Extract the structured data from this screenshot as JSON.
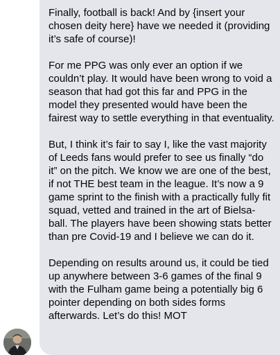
{
  "message": {
    "paragraphs": [
      "Finally, football is back! And by {insert your chosen deity here} have we needed it (providing it’s safe of course)!",
      "For me PPG was only ever an option if we couldn’t play. It would have been wrong to void a season that had got this far and PPG in the model they presented would have been the fairest way to settle everything in that eventuality.",
      "But, I think it’s fair to say I, like the vast majority of Leeds fans would prefer to see us finally “do it” on the pitch. We know we are one of the best, if not THE best team in the league. It’s now a 9 game sprint to the finish with a practically fully fit squad, vetted and trained in the art of Bielsa-ball. The players have been showing stats better than pre Covid-19 and I believe we can do it.",
      "Depending on results around us, it could be tied up anywhere between 3-6 games of the final 9 with the Fulham game being a potentially big 6 pointer depending on both sides forms afterwards. Let’s do this! MOT"
    ]
  },
  "colors": {
    "bubble_background": "#e4e6eb",
    "text": "#050505",
    "page_background": "#ffffff"
  },
  "icons": {
    "avatar": "user-avatar-photo"
  }
}
